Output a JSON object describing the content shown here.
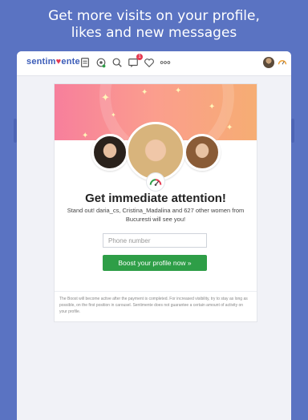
{
  "promo": {
    "line1": "Get more visits on your profile,",
    "line2": "likes and new messages"
  },
  "app": {
    "logo_prefix": "sentim",
    "logo_heart": "♥",
    "logo_suffix": "ente",
    "nav_badge_count": "1"
  },
  "boost": {
    "title": "Get immediate attention!",
    "subtitle": "Stand out! daria_cs, Cristina_Madalina and 627 other women from Bucuresti will see you!",
    "phone_placeholder": "Phone number",
    "button_label": "Boost your profile now »",
    "disclaimer": "The Boost will become active after the payment is completed. For increased visibility, try to stay as long as possible, on the first position in carousel. Sentimente does not guarantee a certain amount of activity on your profile."
  },
  "colors": {
    "background": "#5a73c2",
    "accent_green": "#2e9e47",
    "logo_blue": "#3b5cb8",
    "heart_red": "#e53a52"
  },
  "icons": [
    "clipboard-icon",
    "camera-icon",
    "search-icon",
    "chat-icon",
    "heart-icon",
    "more-icon",
    "gauge-icon"
  ]
}
